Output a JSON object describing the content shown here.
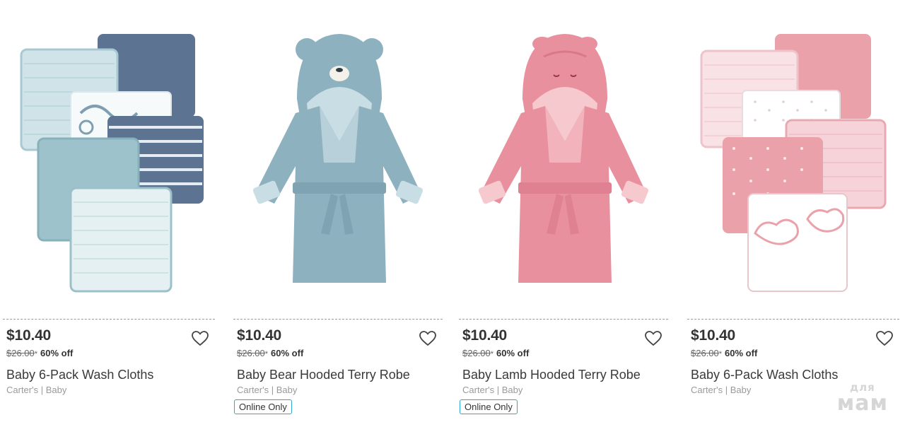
{
  "products": [
    {
      "price": "$10.40",
      "was_price": "$26.00",
      "was_marker": "*",
      "discount": "60% off",
      "name": "Baby 6-Pack Wash Cloths",
      "brand": "Carter's | Baby",
      "badge": "",
      "image_icon": "blue-washcloths-image",
      "wishlist_icon": "heart-outline-icon"
    },
    {
      "price": "$10.40",
      "was_price": "$26.00",
      "was_marker": "*",
      "discount": "60% off",
      "name": "Baby Bear Hooded Terry Robe",
      "brand": "Carter's | Baby",
      "badge": "Online Only",
      "image_icon": "blue-bear-robe-image",
      "wishlist_icon": "heart-outline-icon"
    },
    {
      "price": "$10.40",
      "was_price": "$26.00",
      "was_marker": "*",
      "discount": "60% off",
      "name": "Baby Lamb Hooded Terry Robe",
      "brand": "Carter's | Baby",
      "badge": "Online Only",
      "image_icon": "pink-lamb-robe-image",
      "wishlist_icon": "heart-outline-icon"
    },
    {
      "price": "$10.40",
      "was_price": "$26.00",
      "was_marker": "*",
      "discount": "60% off",
      "name": "Baby 6-Pack Wash Cloths",
      "brand": "Carter's | Baby",
      "badge": "",
      "image_icon": "pink-washcloths-image",
      "wishlist_icon": "heart-outline-icon"
    }
  ],
  "watermark": {
    "top": "для",
    "main": "мам"
  },
  "colors": {
    "badge_border": "#2aa7c9",
    "blue_fabric": "#8eb1c0",
    "navy_fabric": "#5d7392",
    "pink_fabric": "#e9909e",
    "text_dark": "#333333",
    "text_muted": "#9a9a9a"
  }
}
